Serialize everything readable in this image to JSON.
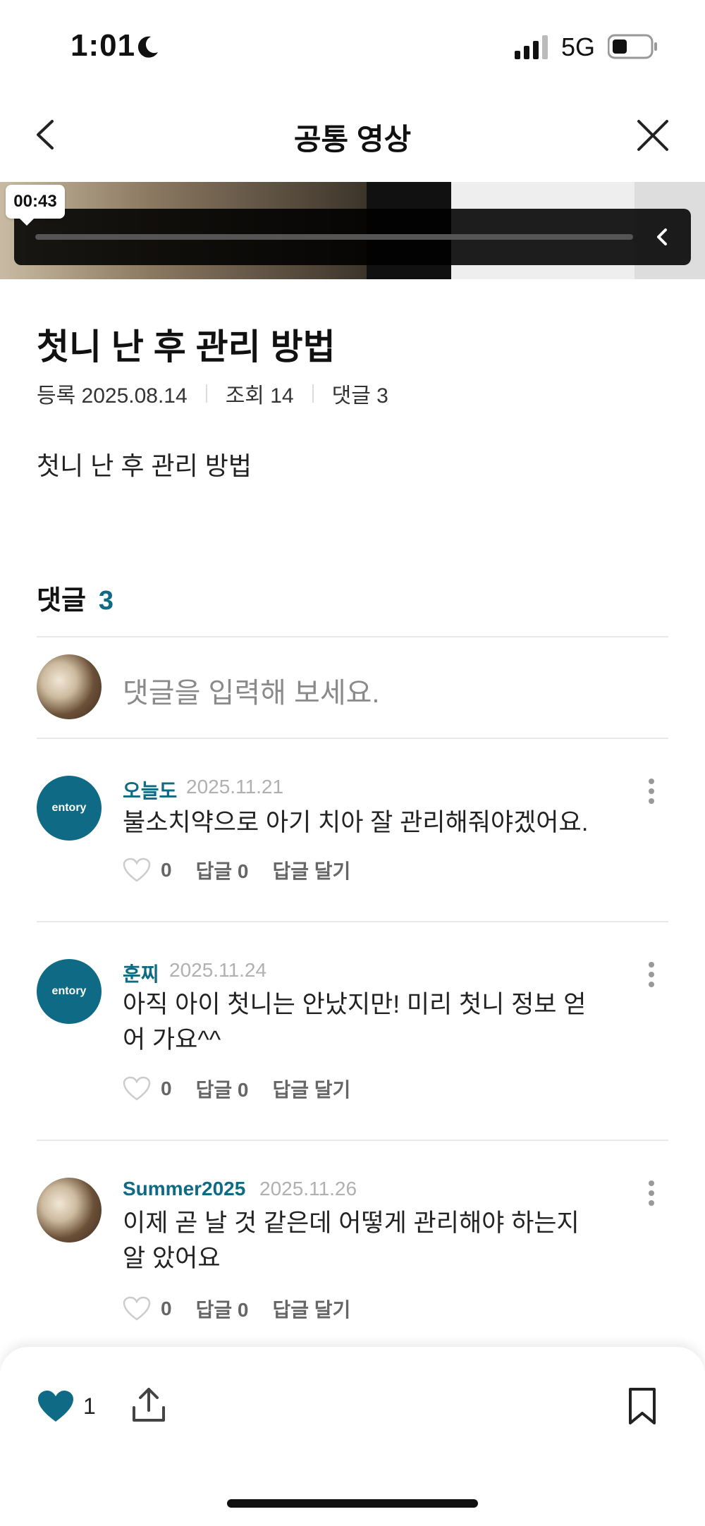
{
  "status_bar": {
    "time": "1:01",
    "network": "5G"
  },
  "nav": {
    "title": "공통 영상"
  },
  "video": {
    "timestamp": "00:43"
  },
  "post": {
    "title": "첫니 난 후 관리 방법",
    "meta_date": "등록 2025.08.14",
    "meta_views": "조회 14",
    "meta_comments": "댓글 3",
    "body": "첫니 난 후 관리 방법"
  },
  "comments_section": {
    "label": "댓글",
    "count": "3",
    "input_placeholder": "댓글을 입력해 보세요."
  },
  "comments": [
    {
      "author": "오늘도",
      "date": "2025.11.21",
      "text": "불소치약으로 아기 치아 잘 관리해줘야겠어요.",
      "likes": "0",
      "replies": "답글 0",
      "reply_action": "답글 달기",
      "avatar": "entory-logo"
    },
    {
      "author": "훈찌",
      "date": "2025.11.24",
      "text": "아직 아이 첫니는 안났지만! 미리 첫니 정보 얻어 가요^^",
      "likes": "0",
      "replies": "답글 0",
      "reply_action": "답글 달기",
      "avatar": "entory-logo"
    },
    {
      "author": "Summer2025",
      "date": "2025.11.26",
      "text": "이제 곧 날 것 같은데 어떻게 관리해야 하는지 알 았어요",
      "likes": "0",
      "replies": "답글 0",
      "reply_action": "답글 달기",
      "avatar": "user-photo"
    }
  ],
  "bottom_bar": {
    "like_count": "1"
  },
  "brand": {
    "accent": "#0f6a86",
    "like": "#0f6a86"
  },
  "avatar_brand_text": "entory"
}
